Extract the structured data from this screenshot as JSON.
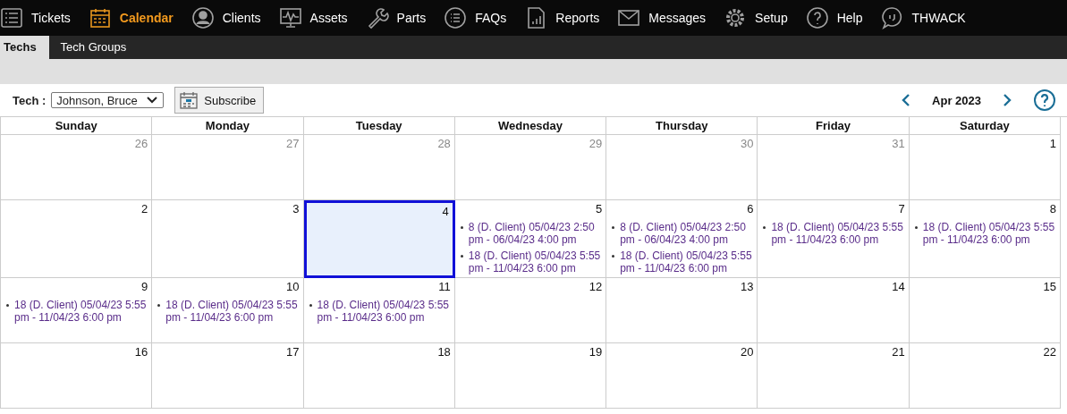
{
  "nav": [
    {
      "label": "Tickets",
      "selected": false
    },
    {
      "label": "Calendar",
      "selected": true
    },
    {
      "label": "Clients",
      "selected": false
    },
    {
      "label": "Assets",
      "selected": false
    },
    {
      "label": "Parts",
      "selected": false
    },
    {
      "label": "FAQs",
      "selected": false
    },
    {
      "label": "Reports",
      "selected": false
    },
    {
      "label": "Messages",
      "selected": false
    },
    {
      "label": "Setup",
      "selected": false
    },
    {
      "label": "Help",
      "selected": false
    },
    {
      "label": "THWACK",
      "selected": false
    }
  ],
  "subtabs": [
    {
      "label": "Techs",
      "selected": true
    },
    {
      "label": "Tech Groups",
      "selected": false
    }
  ],
  "toolbar": {
    "tech_label": "Tech :",
    "tech_value": "Johnson, Bruce",
    "subscribe": "Subscribe",
    "month": "Apr 2023"
  },
  "weekdays": [
    "Sunday",
    "Monday",
    "Tuesday",
    "Wednesday",
    "Thursday",
    "Friday",
    "Saturday"
  ],
  "weeks": [
    [
      {
        "day": "26",
        "muted": true,
        "selected": false
      },
      {
        "day": "27",
        "muted": true,
        "selected": false
      },
      {
        "day": "28",
        "muted": true,
        "selected": false
      },
      {
        "day": "29",
        "muted": true,
        "selected": false
      },
      {
        "day": "30",
        "muted": true,
        "selected": false
      },
      {
        "day": "31",
        "muted": true,
        "selected": false
      },
      {
        "day": "1",
        "muted": false,
        "selected": false
      }
    ],
    [
      {
        "day": "2",
        "muted": false,
        "selected": false
      },
      {
        "day": "3",
        "muted": false,
        "selected": false
      },
      {
        "day": "4",
        "muted": false,
        "selected": true
      },
      {
        "day": "5",
        "muted": false,
        "selected": false,
        "events": [
          "8 (D. Client) 05/04/23 2:50 pm - 06/04/23 4:00 pm",
          "18 (D. Client) 05/04/23 5:55 pm - 11/04/23 6:00 pm"
        ]
      },
      {
        "day": "6",
        "muted": false,
        "selected": false,
        "events": [
          "8 (D. Client) 05/04/23 2:50 pm - 06/04/23 4:00 pm",
          "18 (D. Client) 05/04/23 5:55 pm - 11/04/23 6:00 pm"
        ]
      },
      {
        "day": "7",
        "muted": false,
        "selected": false,
        "events": [
          "18 (D. Client) 05/04/23 5:55 pm - 11/04/23 6:00 pm"
        ]
      },
      {
        "day": "8",
        "muted": false,
        "selected": false,
        "events": [
          "18 (D. Client) 05/04/23 5:55 pm - 11/04/23 6:00 pm"
        ]
      }
    ],
    [
      {
        "day": "9",
        "muted": false,
        "selected": false,
        "events": [
          "18 (D. Client) 05/04/23 5:55 pm - 11/04/23 6:00 pm"
        ]
      },
      {
        "day": "10",
        "muted": false,
        "selected": false,
        "events": [
          "18 (D. Client) 05/04/23 5:55 pm - 11/04/23 6:00 pm"
        ]
      },
      {
        "day": "11",
        "muted": false,
        "selected": false,
        "events": [
          "18 (D. Client) 05/04/23 5:55 pm - 11/04/23 6:00 pm"
        ]
      },
      {
        "day": "12",
        "muted": false,
        "selected": false
      },
      {
        "day": "13",
        "muted": false,
        "selected": false
      },
      {
        "day": "14",
        "muted": false,
        "selected": false
      },
      {
        "day": "15",
        "muted": false,
        "selected": false
      }
    ],
    [
      {
        "day": "16",
        "muted": false,
        "selected": false
      },
      {
        "day": "17",
        "muted": false,
        "selected": false
      },
      {
        "day": "18",
        "muted": false,
        "selected": false
      },
      {
        "day": "19",
        "muted": false,
        "selected": false
      },
      {
        "day": "20",
        "muted": false,
        "selected": false
      },
      {
        "day": "21",
        "muted": false,
        "selected": false
      },
      {
        "day": "22",
        "muted": false,
        "selected": false
      }
    ]
  ]
}
